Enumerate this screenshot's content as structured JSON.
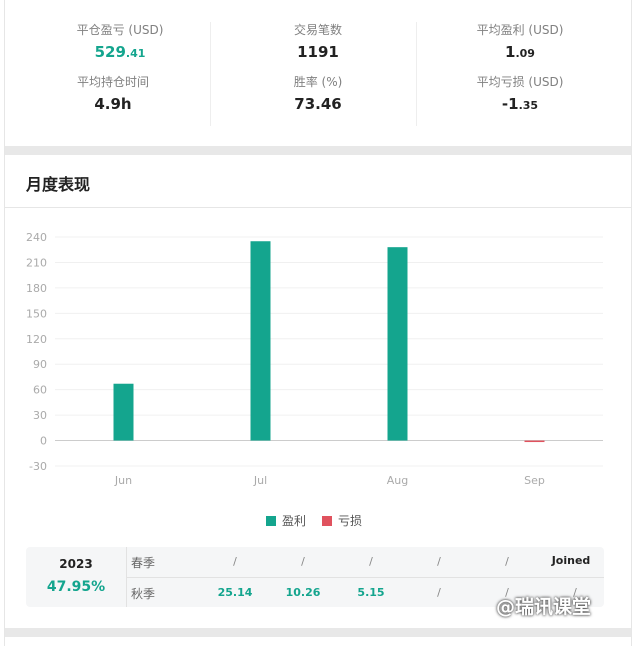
{
  "stats": {
    "closed_pnl": {
      "label": "平仓盈亏 (USD)",
      "int": "529",
      "dec": ".41"
    },
    "trades": {
      "label": "交易笔数",
      "value": "1191"
    },
    "avg_profit": {
      "label": "平均盈利 (USD)",
      "int": "1",
      "dec": ".09"
    },
    "avg_hold": {
      "label": "平均持仓时间",
      "value": "4.9h"
    },
    "win_rate": {
      "label": "胜率 (%)",
      "value": "73.46"
    },
    "avg_loss": {
      "label": "平均亏损 (USD)",
      "int": "-1",
      "dec": ".35"
    }
  },
  "monthly": {
    "title": "月度表现"
  },
  "chart_data": {
    "type": "bar",
    "categories": [
      "Jun",
      "Jul",
      "Aug",
      "Sep"
    ],
    "series": [
      {
        "name": "盈利",
        "color": "#14a58e",
        "values": [
          67,
          235,
          228,
          0
        ]
      },
      {
        "name": "亏损",
        "color": "#e0525e",
        "values": [
          0,
          0,
          0,
          -1.2
        ]
      }
    ],
    "y_ticks": [
      240,
      210,
      180,
      150,
      120,
      90,
      60,
      30,
      0,
      -30
    ],
    "ylim": [
      -30,
      240
    ],
    "grid": true,
    "legend": "bottom"
  },
  "legend": {
    "profit": "盈利",
    "loss": "亏损"
  },
  "year_table": {
    "year": "2023",
    "pct": "47.95%",
    "row1": {
      "season": "春季",
      "cells": [
        "/",
        "/",
        "/",
        "/",
        "/"
      ],
      "joined": "Joined"
    },
    "row2": {
      "season": "秋季",
      "cells": [
        "25.14",
        "10.26",
        "5.15",
        "/",
        "/",
        "/"
      ]
    }
  },
  "watermark": "@瑞讯课堂"
}
